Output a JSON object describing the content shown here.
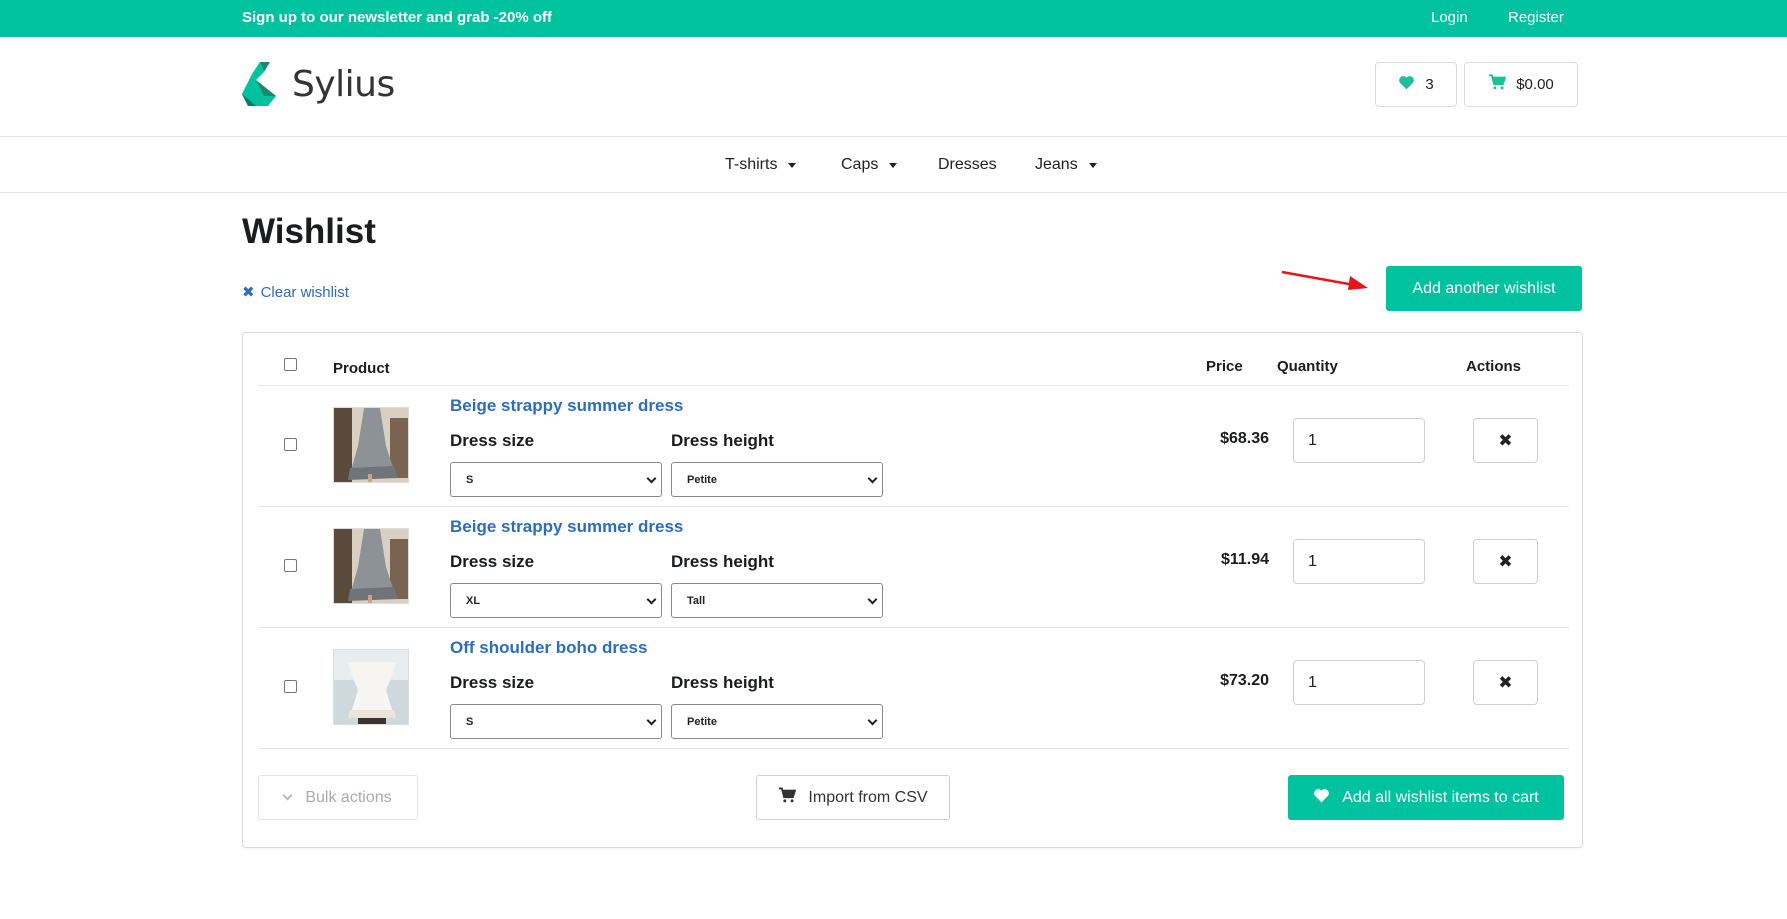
{
  "topbar": {
    "promo": "Sign up to our newsletter and grab -20% off",
    "login": "Login",
    "register": "Register"
  },
  "header": {
    "logo_text": "Sylius",
    "wishlist_count": "3",
    "cart_total": "$0.00"
  },
  "nav": {
    "items": [
      {
        "label": "T-shirts",
        "dropdown": true
      },
      {
        "label": "Caps",
        "dropdown": true
      },
      {
        "label": "Dresses",
        "dropdown": false
      },
      {
        "label": "Jeans",
        "dropdown": true
      }
    ]
  },
  "page": {
    "title": "Wishlist",
    "clear_label": "Clear wishlist",
    "add_wishlist_label": "Add another wishlist"
  },
  "table": {
    "headers": {
      "product": "Product",
      "price": "Price",
      "quantity": "Quantity",
      "actions": "Actions"
    },
    "rows": [
      {
        "name": "Beige strappy summer dress",
        "size_label": "Dress size",
        "size": "S",
        "height_label": "Dress height",
        "height": "Petite",
        "price": "$68.36",
        "quantity": "1",
        "image": "grey-dress"
      },
      {
        "name": "Beige strappy summer dress",
        "size_label": "Dress size",
        "size": "XL",
        "height_label": "Dress height",
        "height": "Tall",
        "price": "$11.94",
        "quantity": "1",
        "image": "grey-dress"
      },
      {
        "name": "Off shoulder boho dress",
        "size_label": "Dress size",
        "size": "S",
        "height_label": "Dress height",
        "height": "Petite",
        "price": "$73.20",
        "quantity": "1",
        "image": "white-dress"
      }
    ]
  },
  "footer": {
    "bulk_label": "Bulk actions",
    "import_label": "Import from CSV",
    "add_all_label": "Add all wishlist items to cart"
  },
  "colors": {
    "accent": "#00c29e",
    "link": "#2c6dbd",
    "annotation_arrow": "#e8141a"
  }
}
